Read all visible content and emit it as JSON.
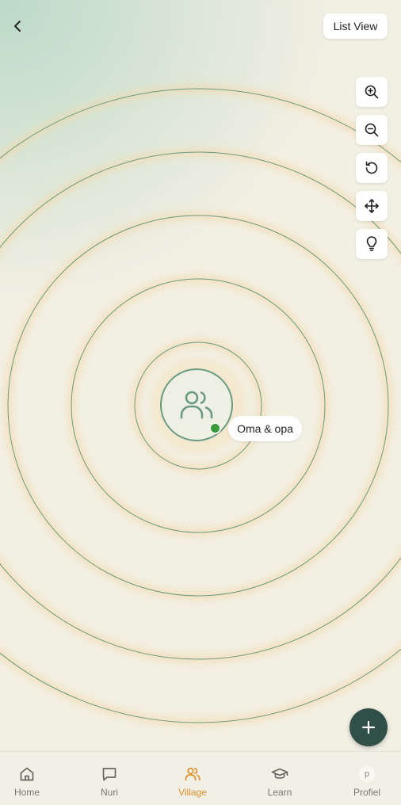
{
  "header": {
    "back_icon": "chevron-left-icon",
    "list_view_label": "List View"
  },
  "tools": [
    {
      "name": "zoom-in",
      "icon": "zoom-in-icon"
    },
    {
      "name": "zoom-out",
      "icon": "zoom-out-icon"
    },
    {
      "name": "reset",
      "icon": "rotate-ccw-icon"
    },
    {
      "name": "move",
      "icon": "move-icon"
    },
    {
      "name": "tips",
      "icon": "lightbulb-icon"
    }
  ],
  "village": {
    "center_icon": "users-icon",
    "status_color": "#3a9b3e",
    "member_label": "Oma & opa"
  },
  "fab": {
    "icon": "plus-icon"
  },
  "nav": {
    "items": [
      {
        "label": "Home",
        "icon": "home-icon"
      },
      {
        "label": "Nuri",
        "icon": "chat-icon"
      },
      {
        "label": "Village",
        "icon": "users-icon",
        "active": true
      },
      {
        "label": "Learn",
        "icon": "graduation-cap-icon"
      },
      {
        "label": "Profiel",
        "icon": "avatar",
        "avatar_letter": "p"
      }
    ]
  },
  "colors": {
    "accent": "#e0902c",
    "ring": "#6a9a80",
    "fab": "#2f4f47"
  }
}
